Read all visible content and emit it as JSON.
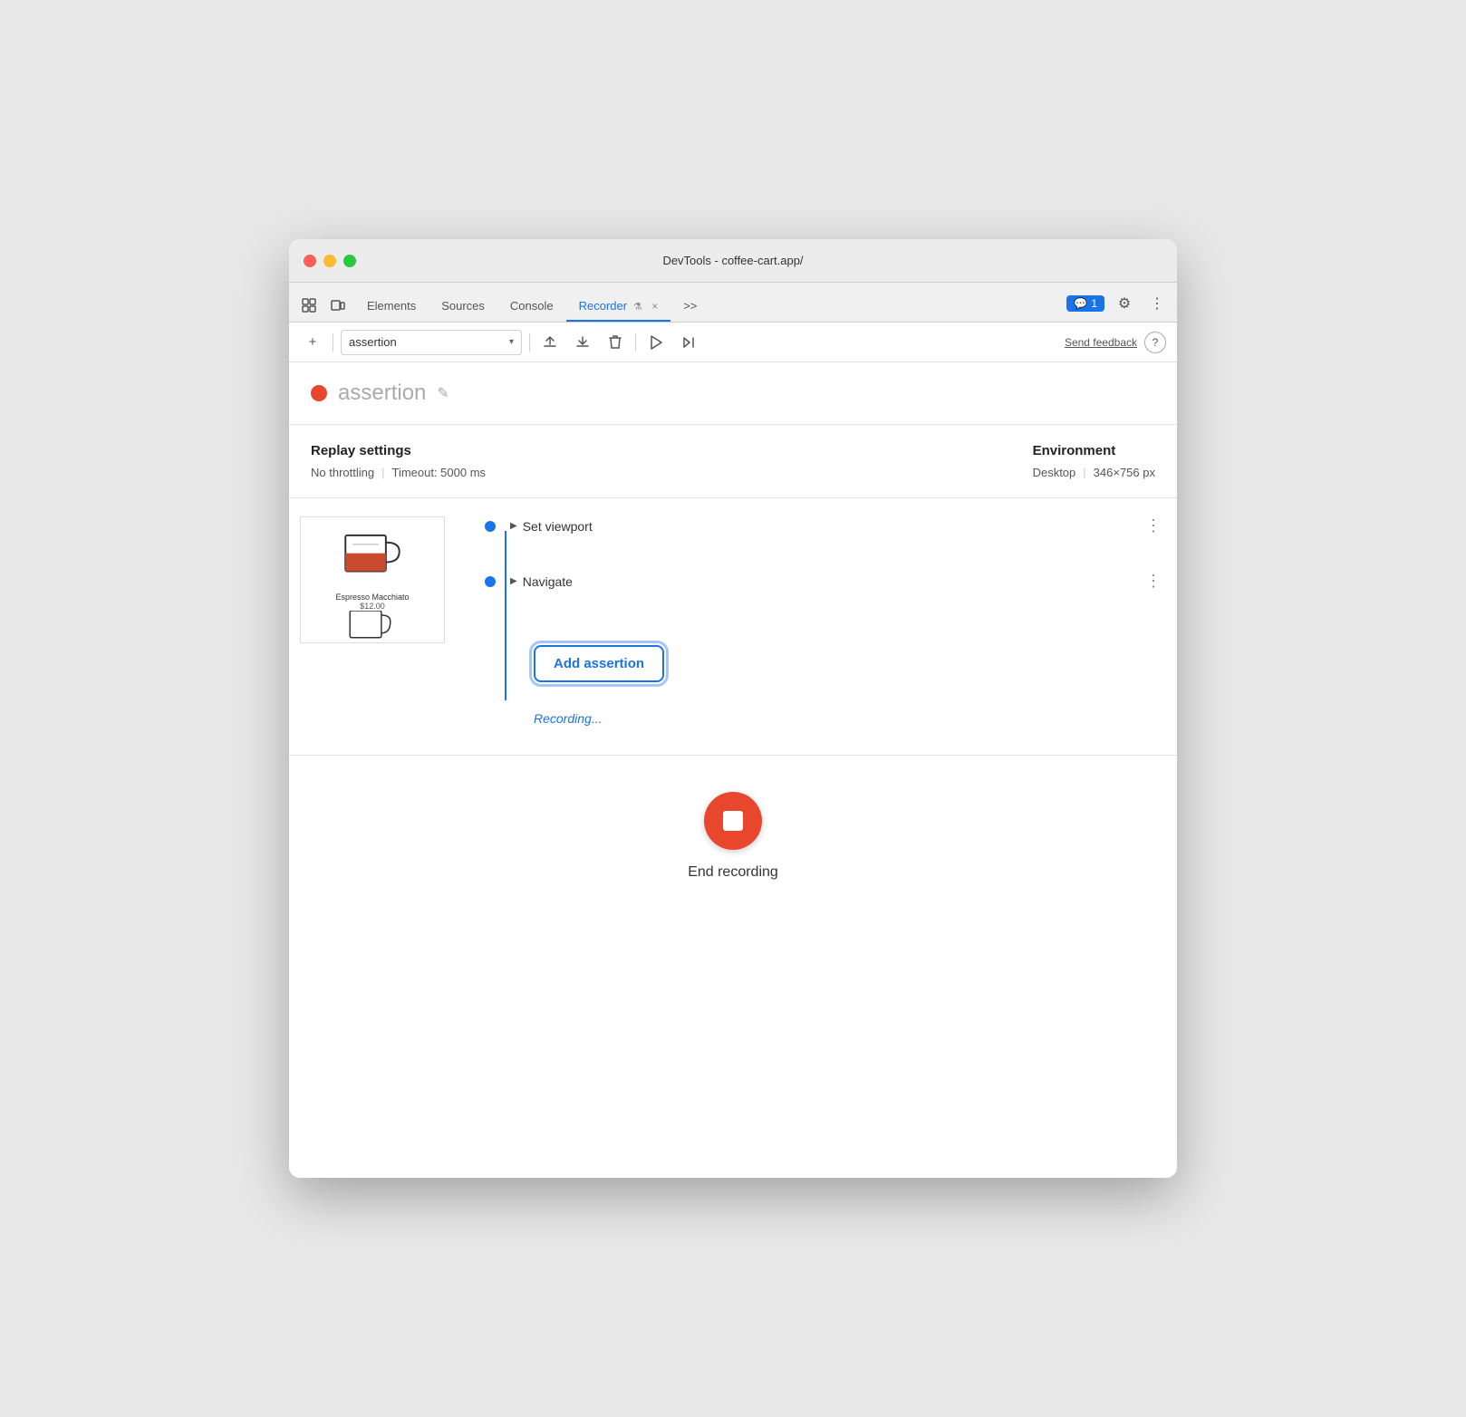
{
  "window": {
    "title": "DevTools - coffee-cart.app/"
  },
  "tabs": {
    "items": [
      {
        "label": "Elements",
        "active": false
      },
      {
        "label": "Sources",
        "active": false
      },
      {
        "label": "Console",
        "active": false
      },
      {
        "label": "Recorder",
        "active": true
      }
    ],
    "more_label": ">>",
    "close_label": "×",
    "badge_count": "1"
  },
  "toolbar": {
    "add_label": "+",
    "recording_name": "assertion",
    "send_feedback": "Send feedback",
    "help": "?"
  },
  "recording": {
    "title": "assertion",
    "dot_color": "#e8472e"
  },
  "replay_settings": {
    "title": "Replay settings",
    "throttling": "No throttling",
    "timeout": "Timeout: 5000 ms"
  },
  "environment": {
    "title": "Environment",
    "device": "Desktop",
    "size": "346×756 px"
  },
  "steps": [
    {
      "label": "Set viewport"
    },
    {
      "label": "Navigate"
    }
  ],
  "add_assertion": {
    "label": "Add assertion"
  },
  "recording_status": {
    "text": "Recording..."
  },
  "end_recording": {
    "label": "End recording"
  },
  "icons": {
    "cursor_tool": "⬚",
    "device_mode": "⬜",
    "elements": "Elements",
    "sources": "Sources",
    "console": "Console",
    "recorder": "Recorder",
    "gear": "⚙",
    "more_vert": "⋮",
    "chat": "💬",
    "upload": "⬆",
    "download": "⬇",
    "delete": "🗑",
    "play": "▶",
    "replay": "↺",
    "edit": "✎",
    "chevron_down": "▾"
  }
}
